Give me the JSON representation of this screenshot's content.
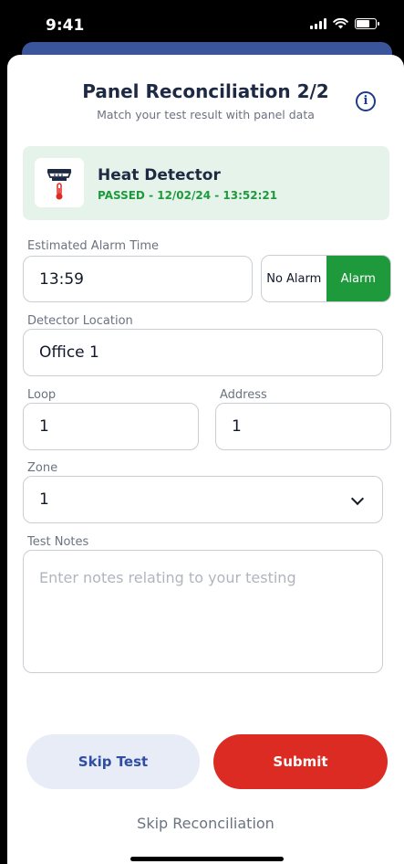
{
  "status_bar": {
    "time": "9:41"
  },
  "header": {
    "title": "Panel Reconciliation 2/2",
    "subtitle": "Match your test result with panel data",
    "info_icon": "info-circle-icon"
  },
  "result_card": {
    "icon": "heat-detector-icon",
    "title": "Heat Detector",
    "status_text": "PASSED - 12/02/24 - 13:52:21",
    "status_color": "#1e9a3c",
    "background": "#e6f3ea"
  },
  "form": {
    "alarm_time": {
      "label": "Estimated Alarm Time",
      "value": "13:59"
    },
    "alarm_toggle": {
      "options": [
        "No Alarm",
        "Alarm"
      ],
      "selected": "Alarm"
    },
    "detector_location": {
      "label": "Detector Location",
      "value": "Office 1"
    },
    "loop": {
      "label": "Loop",
      "value": "1"
    },
    "address": {
      "label": "Address",
      "value": "1"
    },
    "zone": {
      "label": "Zone",
      "value": "1",
      "icon": "chevron-down-icon"
    },
    "test_notes": {
      "label": "Test Notes",
      "value": "",
      "placeholder": "Enter notes relating to your testing"
    }
  },
  "actions": {
    "skip_test": "Skip Test",
    "submit": "Submit",
    "skip_reconciliation": "Skip Reconciliation"
  },
  "colors": {
    "accent_green": "#1e9a3c",
    "submit_red": "#dc2b22",
    "navy": "#1e2a44",
    "skip_button_bg": "#e8ecf6",
    "skip_button_text": "#2f4ea3"
  }
}
